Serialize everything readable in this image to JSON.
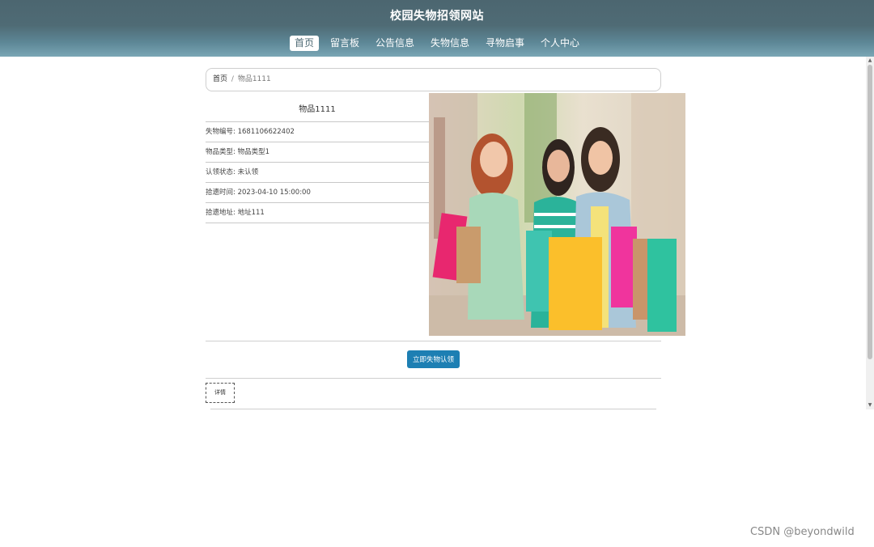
{
  "site": {
    "title": "校园失物招领网站"
  },
  "nav": {
    "items": [
      {
        "label": "首页",
        "active": true
      },
      {
        "label": "留言板",
        "active": false
      },
      {
        "label": "公告信息",
        "active": false
      },
      {
        "label": "失物信息",
        "active": false
      },
      {
        "label": "寻物启事",
        "active": false
      },
      {
        "label": "个人中心",
        "active": false
      }
    ]
  },
  "breadcrumb": {
    "home": "首页",
    "separator": "/",
    "current": "物品1111"
  },
  "item": {
    "name": "物品1111",
    "fields": [
      {
        "label": "失物编号",
        "value": "1681106622402"
      },
      {
        "label": "物品类型",
        "value": "物品类型1"
      },
      {
        "label": "认领状态",
        "value": "未认领"
      },
      {
        "label": "拾遗时间",
        "value": "2023-04-10 15:00:00"
      },
      {
        "label": "拾遗地址",
        "value": "地址111"
      }
    ]
  },
  "actions": {
    "claim_label": "立即失物认领"
  },
  "tabs": {
    "details_label": "详情"
  },
  "watermark": "CSDN @beyondwild",
  "colors": {
    "header": "#4f6b75",
    "button": "#1d7fb3"
  },
  "icons": {
    "scroll_up": "triangle-up",
    "scroll_down": "triangle-down"
  }
}
